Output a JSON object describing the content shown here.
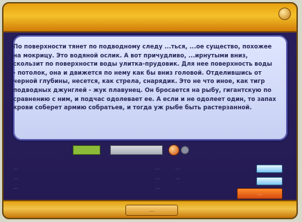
{
  "colors": {
    "frame": "#241a52",
    "panel": "#c6d0f2",
    "gold": "#f4c02a",
    "green": "#8cbc3a",
    "orange": "#d64b10",
    "blue": "#7ac6f2",
    "stats_text": "#6b7cc9"
  },
  "story": {
    "text": "По поверхности тянет по подводному следу ...ться, ...ое существо, похожее на мокрицу. Это водяной ослик. А вот причудливо, ...ирнутыми вниз, скользит по поверхности воды улитка-прудовик. Для нее поверхность воды - потолок, она и движется по нему как бы вниз головой. Отделившись от черной глубины, несется, как стрела, снарядик. Это не что иное, как тигр подводных джунглей - жук плавунец. Он бросается на рыбу, гигантскую по сравнению с ним, и подчас одолевает ее. А если и не одолеет один, то запах крови соберет армию собратьев, и тогда уж рыбе быть растерзанной."
  },
  "stats": {
    "left": [
      {
        "label": "...",
        "value": "..."
      },
      {
        "label": "...",
        "value": "..."
      },
      {
        "label": "...",
        "value": "..."
      }
    ],
    "right": [
      {
        "label": "...",
        "value": ""
      },
      {
        "label": "...",
        "value": ""
      }
    ]
  },
  "buttons": {
    "orange_label": "...",
    "bottom_label": "..."
  }
}
